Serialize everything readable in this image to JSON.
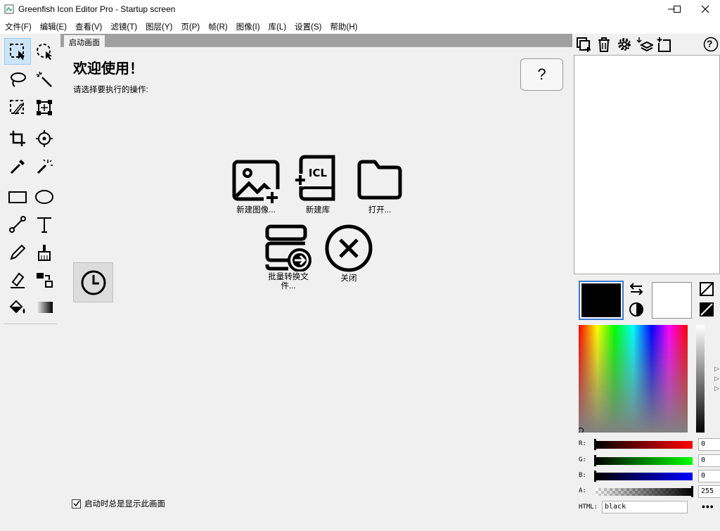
{
  "window": {
    "title": "Greenfish Icon Editor Pro - Startup screen"
  },
  "menu": [
    "文件(F)",
    "编辑(E)",
    "查看(V)",
    "滤镜(T)",
    "图层(Y)",
    "页(P)",
    "帧(R)",
    "图像(I)",
    "库(L)",
    "设置(S)",
    "帮助(H)"
  ],
  "tabs": [
    "启动画面"
  ],
  "start": {
    "welcome": "欢迎使用！",
    "prompt": "请选择要执行的操作:",
    "help_label": "?",
    "actions": {
      "new_image": "新建图像...",
      "new_library": "新建库",
      "open": "打开...",
      "batch": "批量转换文件...",
      "close": "关闭"
    },
    "show_on_startup": "启动时总是显示此画面",
    "show_on_startup_checked": true
  },
  "color": {
    "primary": "#000000",
    "secondary": "#ffffff",
    "r_label": "R:",
    "g_label": "G:",
    "b_label": "B:",
    "a_label": "A:",
    "r": "0",
    "g": "0",
    "b": "0",
    "a": "255",
    "html_label": "HTML:",
    "html_value": "black",
    "more_label": "•••"
  },
  "right_toolbar": {
    "help_label": "?"
  },
  "accent": "#3b79d4"
}
